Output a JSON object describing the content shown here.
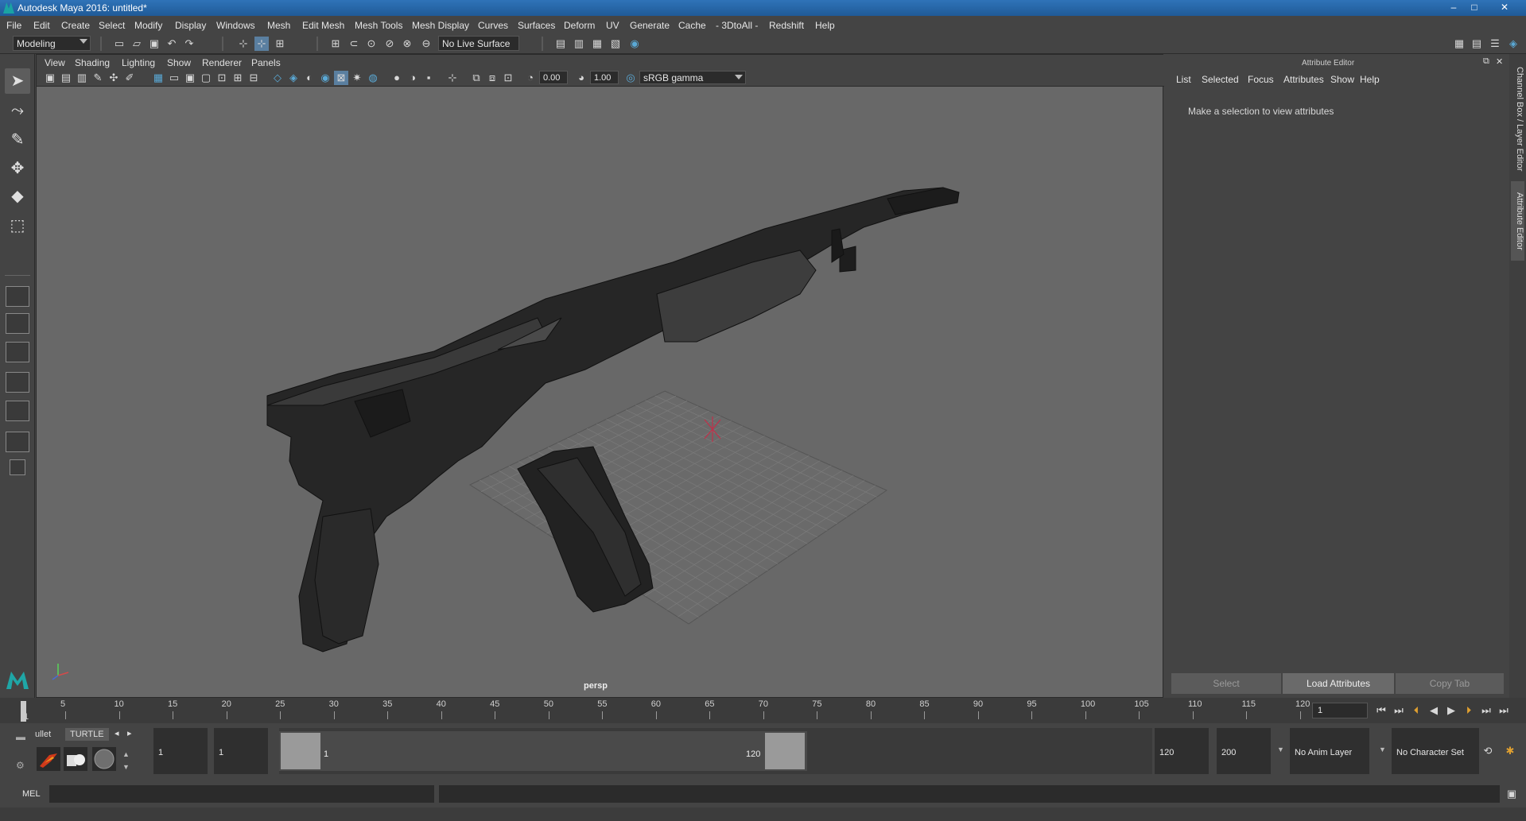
{
  "window": {
    "title": "Autodesk Maya 2016: untitled*",
    "controls": [
      "–",
      "□",
      "✕"
    ]
  },
  "menubar": [
    "File",
    "Edit",
    "Create",
    "Select",
    "Modify",
    "Display",
    "Windows",
    "Mesh",
    "Edit Mesh",
    "Mesh Tools",
    "Mesh Display",
    "Curves",
    "Surfaces",
    "Deform",
    "UV",
    "Generate",
    "Cache",
    "- 3DtoAll -",
    "Redshift",
    "Help"
  ],
  "status_line": {
    "menu_set": "Modeling",
    "live_surface": "No Live Surface"
  },
  "panel": {
    "menus": [
      "View",
      "Shading",
      "Lighting",
      "Show",
      "Renderer",
      "Panels"
    ],
    "exposure": "0.00",
    "gamma": "1.00",
    "color_space": "sRGB gamma",
    "camera": "persp"
  },
  "attribute_editor": {
    "header": "Attribute Editor",
    "tabs": [
      "List",
      "Selected",
      "Focus",
      "Attributes",
      "Show",
      "Help"
    ],
    "message": "Make a selection to view attributes",
    "buttons": {
      "select": "Select",
      "load": "Load Attributes",
      "copy": "Copy Tab"
    }
  },
  "side_tabs": [
    "Channel Box / Layer Editor",
    "Attribute Editor"
  ],
  "time_slider": {
    "ticks": [
      "1",
      "5",
      "10",
      "15",
      "20",
      "25",
      "30",
      "35",
      "40",
      "45",
      "50",
      "55",
      "60",
      "65",
      "70",
      "75",
      "80",
      "85",
      "90",
      "95",
      "100",
      "105",
      "110",
      "115",
      "120"
    ],
    "current_frame": "1"
  },
  "range_slider": {
    "shelf_tabs": [
      "ullet",
      "TURTLE"
    ],
    "start": "1",
    "playback_start": "1",
    "range_start_label": "1",
    "range_end_label": "120",
    "playback_end": "120",
    "end": "200",
    "anim_layer": "No Anim Layer",
    "character_set": "No Character Set"
  },
  "command_line": {
    "language": "MEL"
  },
  "colors": {
    "accent_blue": "#5aa9d6",
    "panel_bg": "#444444",
    "viewport_bg": "#686868"
  }
}
